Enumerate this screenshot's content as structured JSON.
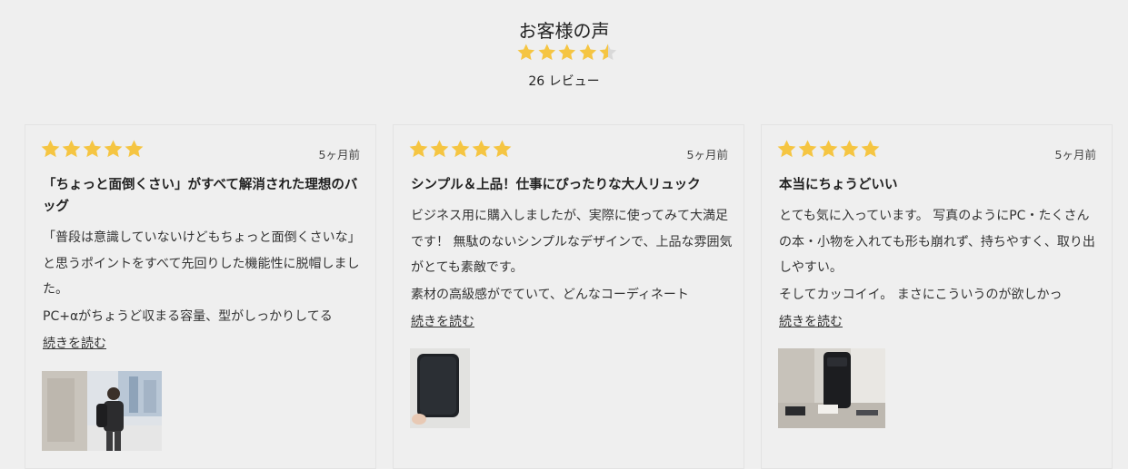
{
  "section": {
    "title": "お客様の声",
    "average_rating": 4.5,
    "review_count_label": "26 レビュー"
  },
  "colors": {
    "star": "#f5c542",
    "star_empty": "#d9d9d9",
    "background": "#efefef"
  },
  "reviews": [
    {
      "rating": 5,
      "date": "5ヶ月前",
      "title": "「ちょっと面倒くさい」がすべて解消された理想のバッグ",
      "paragraphs": [
        "「普段は意識していないけどもちょっと面倒くさいな」と思うポイントをすべて先回りした機能性に脱帽しました。",
        "PC+αがちょうど収まる容量、型がしっかりしてる"
      ],
      "read_more": "続きを読む",
      "photo": "person-with-backpack-photo"
    },
    {
      "rating": 5,
      "date": "5ヶ月前",
      "title": "シンプル＆上品！仕事にぴったりな大人リュック",
      "paragraphs": [
        "ビジネス用に購入しましたが、実際に使ってみて大満足です！ 無駄のないシンプルなデザインで、上品な雰囲気がとても素敵です。",
        "素材の高級感がでていて、どんなコーディネート"
      ],
      "read_more": "続きを読む",
      "photo": "black-bag-photo"
    },
    {
      "rating": 5,
      "date": "5ヶ月前",
      "title": "本当にちょうどいい",
      "paragraphs": [
        "とても気に入っています。 写真のようにPC・たくさんの本・小物を入れても形も崩れず、持ちやすく、取り出しやすい。",
        "そしてカッコイイ。 まさにこういうのが欲しかっ"
      ],
      "read_more": "続きを読む",
      "photo": "backpack-on-desk-photo"
    }
  ]
}
